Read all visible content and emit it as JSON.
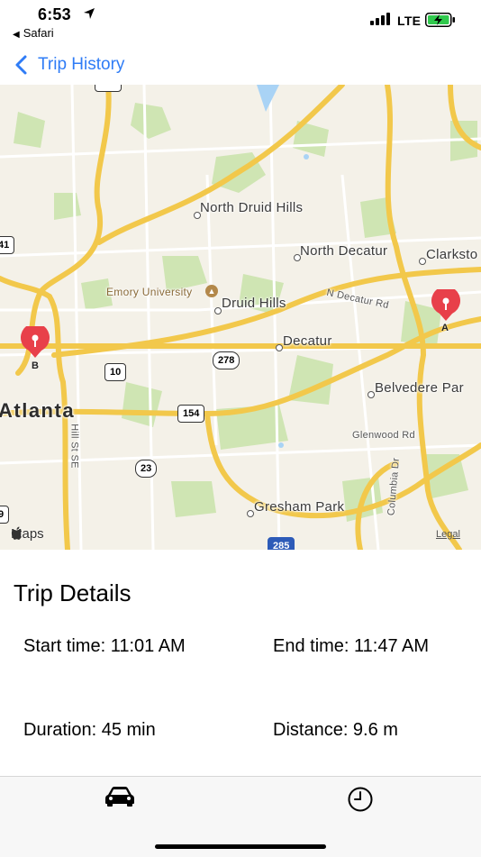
{
  "status_bar": {
    "time": "6:53",
    "back_app": "Safari",
    "network": "LTE"
  },
  "nav": {
    "back_label": "Trip History"
  },
  "map": {
    "labels": [
      "North Druid Hills",
      "North Decatur",
      "Clarksto",
      "Emory University",
      "N Decatur Rd",
      "Druid Hills",
      "Decatur",
      "Belvedere Par",
      "Atlanta",
      "Glenwood Rd",
      "Hill St SE",
      "Columbia Dr",
      "Gresham Park"
    ],
    "shields": [
      "41",
      "278",
      "10",
      "154",
      "23",
      "9",
      "285"
    ],
    "pins": {
      "start": "A",
      "end": "B"
    },
    "attribution": "Maps",
    "legal": "Legal"
  },
  "details": {
    "title": "Trip Details",
    "start": "Start time: 11:01 AM",
    "end": "End time: 11:47 AM",
    "duration": "Duration: 45 min",
    "distance": "Distance: 9.6 m"
  },
  "tabs": [
    {
      "icon": "car-icon"
    },
    {
      "icon": "clock-icon"
    }
  ],
  "colors": {
    "accent": "#2f7cf6",
    "pin": "#e8404a",
    "road_major": "#f2c84b",
    "park": "#cfe5b3"
  }
}
